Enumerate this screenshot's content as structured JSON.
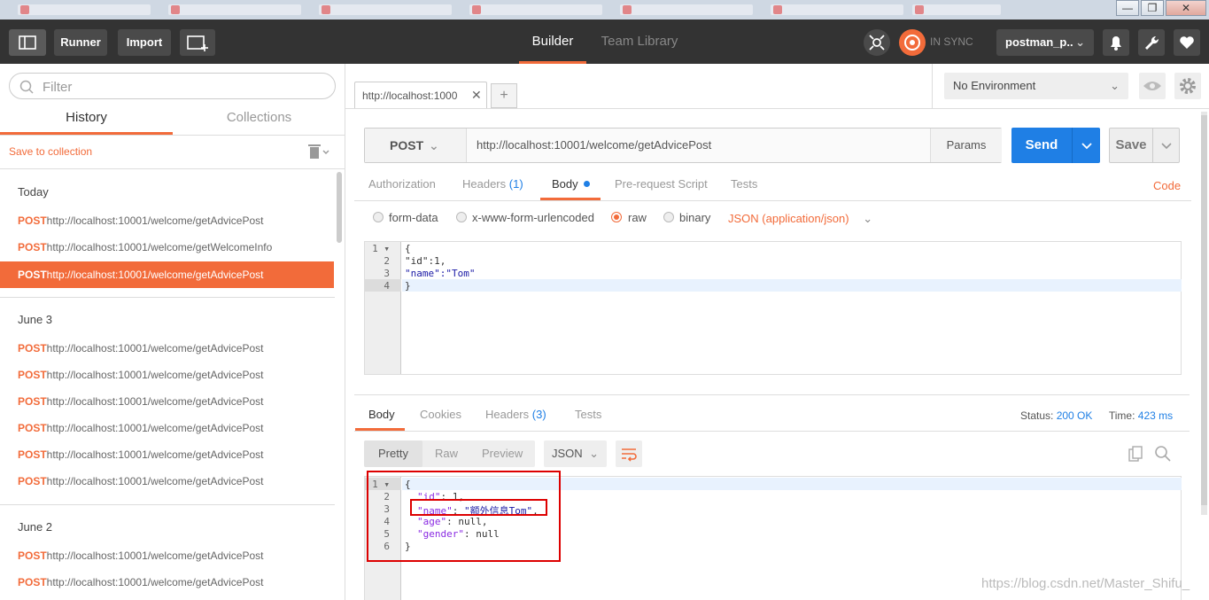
{
  "window": {
    "minimize": "—",
    "restore": "❐",
    "close": "✕"
  },
  "topbar": {
    "runner": "Runner",
    "import": "Import",
    "tabs": [
      "Builder",
      "Team Library"
    ],
    "sync": "IN SYNC",
    "user": "postman_p.."
  },
  "sidebar": {
    "filter_placeholder": "Filter",
    "tabs": [
      "History",
      "Collections"
    ],
    "save_to_collection": "Save to collection",
    "groups": [
      {
        "label": "Today",
        "items": [
          {
            "method": "POST",
            "url": "http://localhost:10001/welcome/getAdvicePost"
          },
          {
            "method": "POST",
            "url": "http://localhost:10001/welcome/getWelcomeInfo"
          },
          {
            "method": "POST",
            "url": "http://localhost:10001/welcome/getAdvicePost"
          }
        ]
      },
      {
        "label": "June 3",
        "items": [
          {
            "method": "POST",
            "url": "http://localhost:10001/welcome/getAdvicePost"
          },
          {
            "method": "POST",
            "url": "http://localhost:10001/welcome/getAdvicePost"
          },
          {
            "method": "POST",
            "url": "http://localhost:10001/welcome/getAdvicePost"
          },
          {
            "method": "POST",
            "url": "http://localhost:10001/welcome/getAdvicePost"
          },
          {
            "method": "POST",
            "url": "http://localhost:10001/welcome/getAdvicePost"
          },
          {
            "method": "POST",
            "url": "http://localhost:10001/welcome/getAdvicePost"
          }
        ]
      },
      {
        "label": "June 2",
        "items": [
          {
            "method": "POST",
            "url": "http://localhost:10001/welcome/getAdvicePost"
          },
          {
            "method": "POST",
            "url": "http://localhost:10001/welcome/getAdvicePost"
          }
        ]
      }
    ]
  },
  "request": {
    "tab_title": "http://localhost:1000",
    "tab_close": "✕",
    "new_tab": "+",
    "environment": "No Environment",
    "method": "POST",
    "url": "http://localhost:10001/welcome/getAdvicePost",
    "params": "Params",
    "send": "Send",
    "save": "Save",
    "tabs": {
      "authorization": "Authorization",
      "headers": "Headers",
      "headers_count": "(1)",
      "body": "Body",
      "prerequest": "Pre-request Script",
      "tests": "Tests"
    },
    "code": "Code",
    "body_modes": [
      "form-data",
      "x-www-form-urlencoded",
      "raw",
      "binary"
    ],
    "content_type": "JSON (application/json)",
    "body_lines": [
      "{",
      "\"id\":1,",
      "\"name\":\"Tom\"",
      "}"
    ]
  },
  "response": {
    "tabs": {
      "body": "Body",
      "cookies": "Cookies",
      "headers": "Headers",
      "headers_count": "(3)",
      "tests": "Tests"
    },
    "status_label": "Status:",
    "status_value": "200 OK",
    "time_label": "Time:",
    "time_value": "423 ms",
    "formats": [
      "Pretty",
      "Raw",
      "Preview"
    ],
    "language": "JSON",
    "body": {
      "l1": "{",
      "id_key": "\"id\"",
      "id_val": "1,",
      "name_key": "\"name\"",
      "name_val": "\"额外信息Tom\"",
      "age_key": "\"age\"",
      "age_val": "null,",
      "gender_key": "\"gender\"",
      "gender_val": "null",
      "l6": "}"
    }
  },
  "watermark": "https://blog.csdn.net/Master_Shifu_",
  "colors": {
    "accent": "#f26b3a",
    "send": "#1f7fe5",
    "topbar": "#333333"
  }
}
